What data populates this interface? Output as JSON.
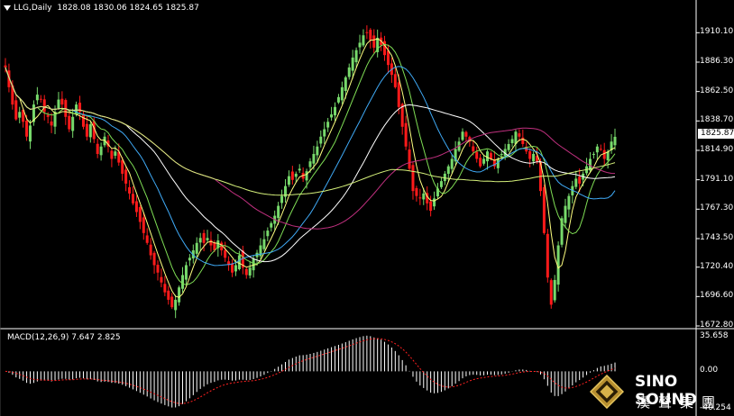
{
  "header": {
    "symbol_label": "LLG,Daily",
    "ohlc": "1828.08 1830.06 1824.65 1825.87"
  },
  "macd_header": "MACD(12,26,9) 7.647 2.825",
  "current_price": "1825.87",
  "logo": {
    "en": "SINO SOUND",
    "cn": "漢聲集團"
  },
  "colors": {
    "background": "#000000",
    "bull_candle": "#77d96b",
    "bear_candle": "#ff1a1a",
    "ma_yellow": "#ffff80",
    "ma_green": "#7fdd55",
    "ma_blue": "#3fa9f5",
    "ma_white": "#ffffff",
    "ma_magenta": "#c0307f",
    "ma_lime": "#d5f07a",
    "macd_hist": "#ffffff",
    "macd_signal": "#ff2020"
  },
  "chart_data": [
    {
      "type": "candlestick",
      "title": "LLG,Daily",
      "ylim": [
        1672.8,
        1922
      ],
      "y_ticks": [
        "1910.10",
        "1886.30",
        "1862.50",
        "1838.70",
        "1814.90",
        "1791.10",
        "1767.30",
        "1743.50",
        "1720.40",
        "1696.60",
        "1672.80"
      ],
      "close_series": [
        1882,
        1866,
        1852,
        1840,
        1846,
        1838,
        1826,
        1835,
        1852,
        1860,
        1856,
        1846,
        1842,
        1835,
        1846,
        1856,
        1852,
        1842,
        1832,
        1842,
        1852,
        1846,
        1834,
        1826,
        1836,
        1824,
        1812,
        1818,
        1826,
        1818,
        1808,
        1814,
        1805,
        1796,
        1788,
        1780,
        1772,
        1765,
        1757,
        1748,
        1740,
        1730,
        1722,
        1716,
        1708,
        1700,
        1694,
        1688,
        1694,
        1704,
        1714,
        1722,
        1728,
        1734,
        1740,
        1744,
        1740,
        1744,
        1738,
        1734,
        1742,
        1734,
        1728,
        1722,
        1716,
        1722,
        1730,
        1720,
        1714,
        1720,
        1727,
        1732,
        1738,
        1743,
        1750,
        1756,
        1762,
        1770,
        1778,
        1786,
        1794,
        1791,
        1796,
        1800,
        1792,
        1798,
        1806,
        1812,
        1818,
        1826,
        1832,
        1838,
        1844,
        1850,
        1858,
        1866,
        1874,
        1882,
        1890,
        1896,
        1902,
        1908,
        1910,
        1904,
        1898,
        1906,
        1900,
        1892,
        1884,
        1876,
        1866,
        1850,
        1834,
        1818,
        1800,
        1782,
        1778,
        1776,
        1780,
        1772,
        1766,
        1776,
        1784,
        1790,
        1796,
        1802,
        1808,
        1816,
        1822,
        1830,
        1826,
        1822,
        1814,
        1808,
        1802,
        1808,
        1814,
        1808,
        1802,
        1808,
        1812,
        1816,
        1820,
        1824,
        1830,
        1826,
        1820,
        1814,
        1808,
        1812,
        1806,
        1782,
        1748,
        1712,
        1690,
        1710,
        1738,
        1760,
        1770,
        1778,
        1786,
        1792,
        1788,
        1796,
        1802,
        1808,
        1812,
        1818,
        1816,
        1808,
        1814,
        1822,
        1825.87
      ],
      "ma_lines": [
        "yellow",
        "green",
        "blue",
        "white",
        "magenta",
        "lime"
      ]
    },
    {
      "type": "bar",
      "title": "MACD(12,26,9) 7.647 2.825",
      "ylim": [
        -40.254,
        35.658
      ],
      "y_ticks": [
        "35.658",
        "0.00",
        "-40.254"
      ],
      "macd_value": 7.647,
      "signal_value": 2.825
    }
  ]
}
